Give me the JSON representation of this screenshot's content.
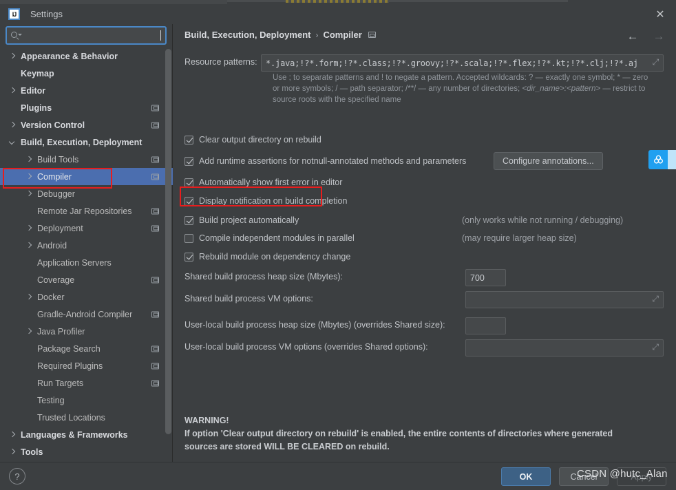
{
  "window": {
    "title": "Settings",
    "logo_text": "IJ",
    "close_label": "✕"
  },
  "search": {
    "value": "",
    "placeholder": ""
  },
  "sidebar": {
    "items": [
      {
        "label": "Appearance & Behavior",
        "indent": 0,
        "arrow": "right",
        "bold": true,
        "badge": false,
        "selected": false
      },
      {
        "label": "Keymap",
        "indent": 0,
        "arrow": "none",
        "bold": true,
        "badge": false,
        "selected": false
      },
      {
        "label": "Editor",
        "indent": 0,
        "arrow": "right",
        "bold": true,
        "badge": false,
        "selected": false
      },
      {
        "label": "Plugins",
        "indent": 0,
        "arrow": "none",
        "bold": true,
        "badge": true,
        "selected": false
      },
      {
        "label": "Version Control",
        "indent": 0,
        "arrow": "right",
        "bold": true,
        "badge": true,
        "selected": false
      },
      {
        "label": "Build, Execution, Deployment",
        "indent": 0,
        "arrow": "down",
        "bold": true,
        "badge": false,
        "selected": false
      },
      {
        "label": "Build Tools",
        "indent": 1,
        "arrow": "right",
        "bold": false,
        "badge": true,
        "selected": false
      },
      {
        "label": "Compiler",
        "indent": 1,
        "arrow": "right",
        "bold": false,
        "badge": true,
        "selected": true
      },
      {
        "label": "Debugger",
        "indent": 1,
        "arrow": "right",
        "bold": false,
        "badge": false,
        "selected": false
      },
      {
        "label": "Remote Jar Repositories",
        "indent": 1,
        "arrow": "none",
        "bold": false,
        "badge": true,
        "selected": false
      },
      {
        "label": "Deployment",
        "indent": 1,
        "arrow": "right",
        "bold": false,
        "badge": true,
        "selected": false
      },
      {
        "label": "Android",
        "indent": 1,
        "arrow": "right",
        "bold": false,
        "badge": false,
        "selected": false
      },
      {
        "label": "Application Servers",
        "indent": 1,
        "arrow": "none",
        "bold": false,
        "badge": false,
        "selected": false
      },
      {
        "label": "Coverage",
        "indent": 1,
        "arrow": "none",
        "bold": false,
        "badge": true,
        "selected": false
      },
      {
        "label": "Docker",
        "indent": 1,
        "arrow": "right",
        "bold": false,
        "badge": false,
        "selected": false
      },
      {
        "label": "Gradle-Android Compiler",
        "indent": 1,
        "arrow": "none",
        "bold": false,
        "badge": true,
        "selected": false
      },
      {
        "label": "Java Profiler",
        "indent": 1,
        "arrow": "right",
        "bold": false,
        "badge": false,
        "selected": false
      },
      {
        "label": "Package Search",
        "indent": 1,
        "arrow": "none",
        "bold": false,
        "badge": true,
        "selected": false
      },
      {
        "label": "Required Plugins",
        "indent": 1,
        "arrow": "none",
        "bold": false,
        "badge": true,
        "selected": false
      },
      {
        "label": "Run Targets",
        "indent": 1,
        "arrow": "none",
        "bold": false,
        "badge": true,
        "selected": false
      },
      {
        "label": "Testing",
        "indent": 1,
        "arrow": "none",
        "bold": false,
        "badge": false,
        "selected": false
      },
      {
        "label": "Trusted Locations",
        "indent": 1,
        "arrow": "none",
        "bold": false,
        "badge": false,
        "selected": false
      },
      {
        "label": "Languages & Frameworks",
        "indent": 0,
        "arrow": "right",
        "bold": true,
        "badge": false,
        "selected": false
      },
      {
        "label": "Tools",
        "indent": 0,
        "arrow": "right",
        "bold": true,
        "badge": false,
        "selected": false
      }
    ]
  },
  "breadcrumb": {
    "root": "Build, Execution, Deployment",
    "separator": "›",
    "current": "Compiler"
  },
  "nav": {
    "back": "←",
    "forward": "→"
  },
  "main": {
    "resource_patterns_label": "Resource patterns:",
    "resource_patterns_value": "*.java;!?*.form;!?*.class;!?*.groovy;!?*.scala;!?*.flex;!?*.kt;!?*.clj;!?*.aj",
    "hint_line1": "Use ; to separate patterns and ! to negate a pattern. Accepted wildcards: ? — exactly one symbol; * — zero",
    "hint_line2_a": "or more symbols; / — path separator; /**/ — any number of directories;  ",
    "hint_line2_i": "<dir_name>:<pattern>",
    "hint_line2_b": " — restrict to",
    "hint_line3": "source roots with the specified name",
    "checkboxes": [
      {
        "label": "Clear output directory on rebuild",
        "checked": true,
        "note": ""
      },
      {
        "label": "Add runtime assertions for notnull-annotated methods and parameters",
        "checked": true,
        "note": ""
      },
      {
        "label": "Automatically show first error in editor",
        "checked": true,
        "note": ""
      },
      {
        "label": "Display notification on build completion",
        "checked": true,
        "note": ""
      },
      {
        "label": "Build project automatically",
        "checked": true,
        "note": "(only works while not running / debugging)"
      },
      {
        "label": "Compile independent modules in parallel",
        "checked": false,
        "note": "(may require larger heap size)"
      },
      {
        "label": "Rebuild module on dependency change",
        "checked": true,
        "note": ""
      }
    ],
    "configure_annotations_button": "Configure annotations...",
    "fields": [
      {
        "label": "Shared build process heap size (Mbytes):",
        "value": "700",
        "wide": false,
        "expand": false
      },
      {
        "label": "Shared build process VM options:",
        "value": "",
        "wide": true,
        "expand": true
      },
      {
        "label": "User-local build process heap size (Mbytes) (overrides Shared size):",
        "value": "",
        "wide": false,
        "expand": false
      },
      {
        "label": "User-local build process VM options (overrides Shared options):",
        "value": "",
        "wide": true,
        "expand": true
      }
    ],
    "warning": {
      "title": "WARNING!",
      "line1": "If option 'Clear output directory on rebuild' is enabled, the entire contents of directories where generated",
      "line2": "sources are stored WILL BE CLEARED on rebuild."
    }
  },
  "footer": {
    "help": "?",
    "ok": "OK",
    "cancel": "Cancel",
    "apply": "Apply"
  },
  "watermark": "CSDN @hutc_Alan",
  "colors": {
    "accent": "#4b6eaf",
    "primary_button": "#3d6185",
    "annotation": "#e81d1d",
    "widget_blue": "#20a0f0"
  }
}
